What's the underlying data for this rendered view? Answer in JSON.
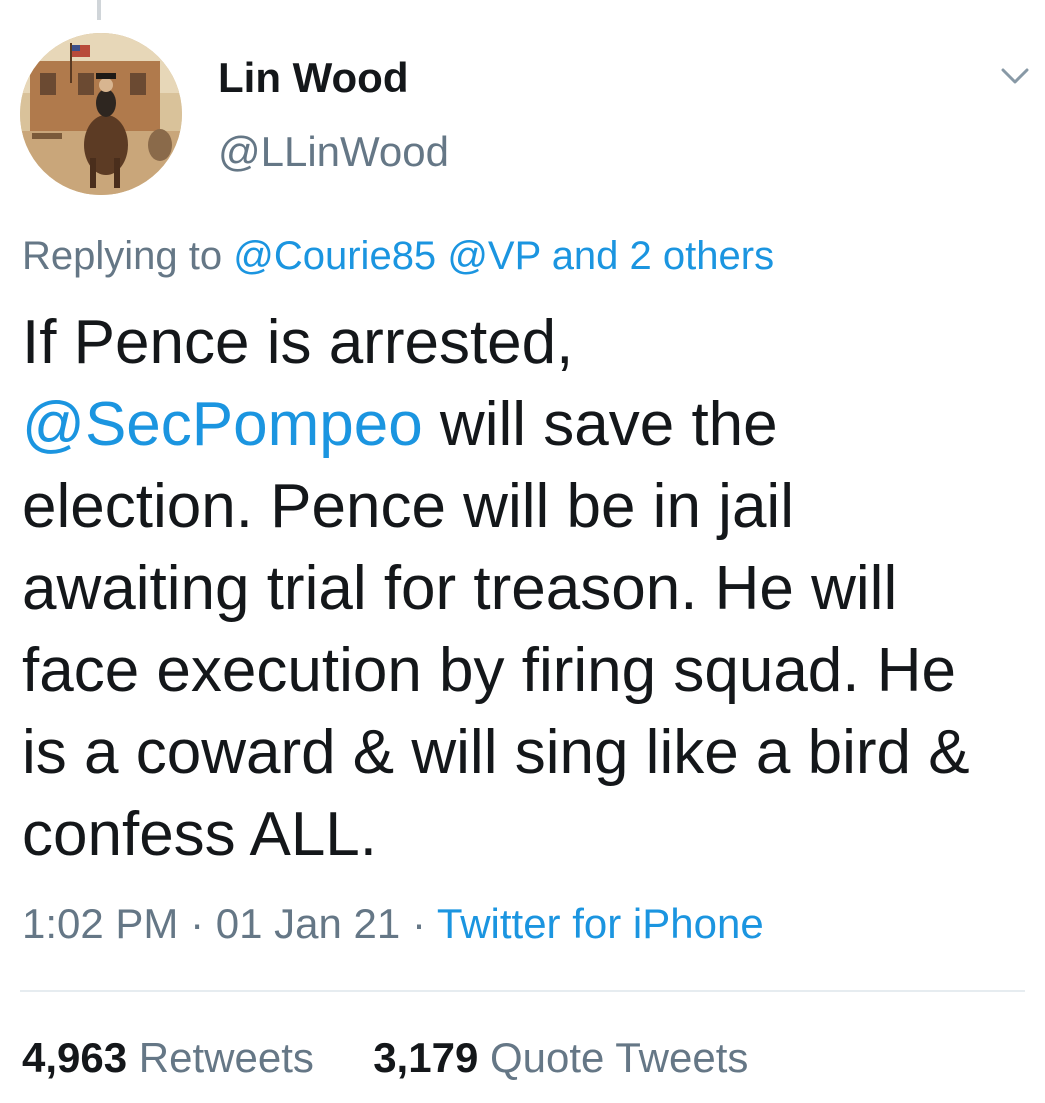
{
  "tweet": {
    "author": {
      "display_name": "Lin Wood",
      "handle": "@LLinWood",
      "avatar_icon": "avatar-image"
    },
    "menu_icon": "chevron-down-icon",
    "replying_to": {
      "prefix": "Replying to",
      "mentions": [
        "@Courie85",
        "@VP"
      ],
      "others": "and 2 others"
    },
    "text_lines": [
      [
        {
          "t": "If Pence is arrested,",
          "link": false
        }
      ],
      [
        {
          "t": "@SecPompeo",
          "link": true
        },
        {
          "t": " will save the",
          "link": false
        }
      ],
      [
        {
          "t": "election. Pence will be in jail",
          "link": false
        }
      ],
      [
        {
          "t": "awaiting trial for treason. He will",
          "link": false
        }
      ],
      [
        {
          "t": "face execution by firing squad. He",
          "link": false
        }
      ],
      [
        {
          "t": "is a coward & will sing like a bird &",
          "link": false
        }
      ],
      [
        {
          "t": "confess ALL.",
          "link": false
        }
      ]
    ],
    "meta": {
      "time": "1:02 PM",
      "separator": "·",
      "date": "01 Jan 21",
      "source": "Twitter for iPhone"
    },
    "stats": {
      "retweets_count": "4,963",
      "retweets_label": "Retweets",
      "quotes_count": "3,179",
      "quotes_label": "Quote Tweets"
    }
  },
  "colors": {
    "link": "#1b95e0",
    "secondary_text": "#657786",
    "primary_text": "#14171a",
    "divider": "#e6ecf0"
  }
}
